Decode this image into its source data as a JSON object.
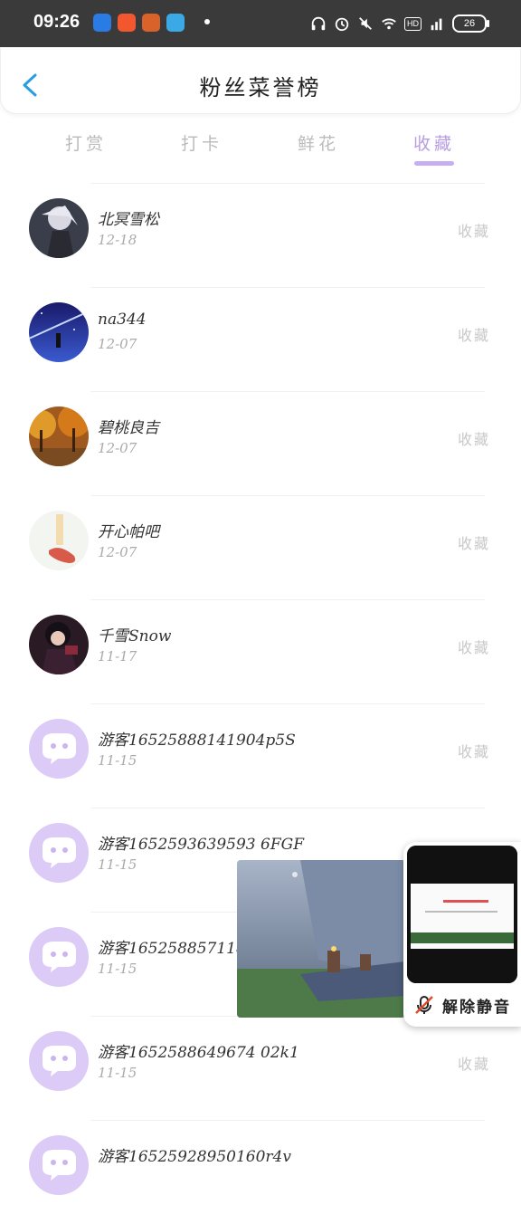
{
  "status_bar": {
    "time": "09:26",
    "hd": "HD",
    "network": "5G",
    "battery": "26"
  },
  "header": {
    "title": "粉丝菜誉榜"
  },
  "tabs": [
    "打赏",
    "打卡",
    "鲜花",
    "收藏"
  ],
  "active_tab": "收藏",
  "fans": [
    {
      "name": "北冥雪松",
      "date": "12-18",
      "action": "收藏",
      "avatar": "anime-character-white-hair"
    },
    {
      "name": "na344",
      "date": "12-07",
      "action": "收藏",
      "avatar": "night-sky-figure"
    },
    {
      "name": "碧桃良吉",
      "date": "12-07",
      "action": "收藏",
      "avatar": "autumn-trees"
    },
    {
      "name": "开心帕吧",
      "date": "12-07",
      "action": "收藏",
      "avatar": "red-shoe-sketch"
    },
    {
      "name": "千雪Snow",
      "date": "11-17",
      "action": "收藏",
      "avatar": "anime-character-dark"
    },
    {
      "name": "游客16525888141904p5S",
      "date": "11-15",
      "action": "收藏",
      "avatar": "default-chat-bubble"
    },
    {
      "name": "游客1652593639593 6FGF",
      "date": "11-15",
      "action": "收藏",
      "avatar": "default-chat-bubble"
    },
    {
      "name": "游客165258857118",
      "date": "11-15",
      "action": "收藏",
      "avatar": "default-chat-bubble"
    },
    {
      "name": "游客1652588649674 02k1",
      "date": "11-15",
      "action": "收藏",
      "avatar": "default-chat-bubble"
    },
    {
      "name": "游客16525928950160r4v",
      "date": "",
      "action": "",
      "avatar": "default-chat-bubble"
    }
  ],
  "floating": {
    "unmute_label": "解除静音"
  },
  "colors": {
    "accent": "#c6aef0",
    "default_avatar": "#dccbf7",
    "status_bar": "#3a3a3a"
  }
}
